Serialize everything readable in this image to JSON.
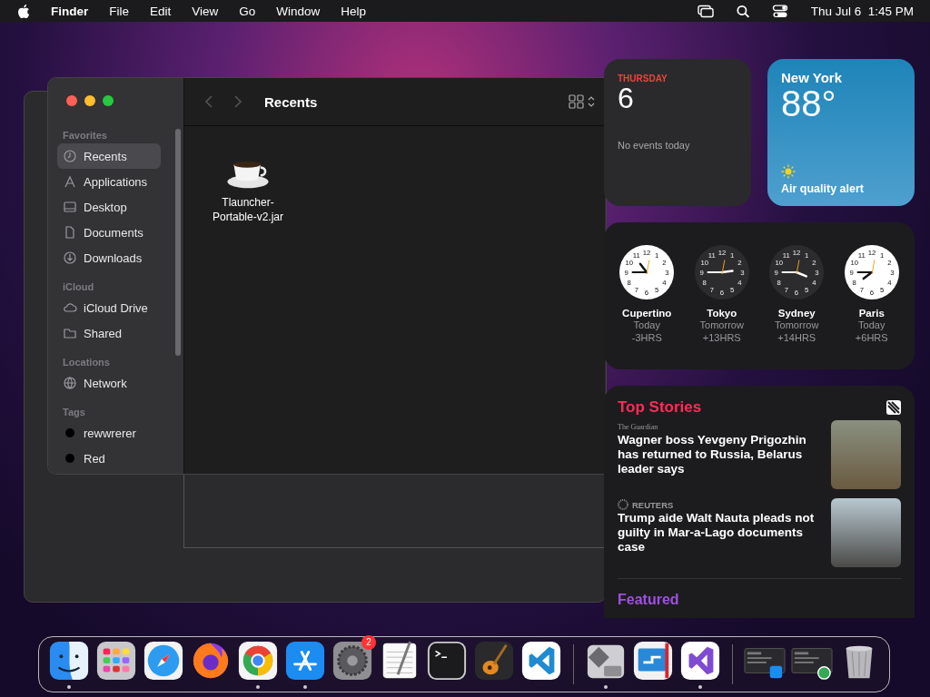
{
  "menu_bar": {
    "app": "Finder",
    "menus": [
      "File",
      "Edit",
      "View",
      "Go",
      "Window",
      "Help"
    ],
    "clock": "Thu Jul 6  1:45 PM"
  },
  "finder": {
    "title": "Recents",
    "sidebar": [
      {
        "heading": "Favorites",
        "items": [
          {
            "label": "Recents",
            "kind": "clock",
            "selected": true
          },
          {
            "label": "Applications",
            "kind": "apps",
            "selected": false
          },
          {
            "label": "Desktop",
            "kind": "desktop",
            "selected": false
          },
          {
            "label": "Documents",
            "kind": "doc",
            "selected": false
          },
          {
            "label": "Downloads",
            "kind": "download",
            "selected": false
          }
        ]
      },
      {
        "heading": "iCloud",
        "items": [
          {
            "label": "iCloud Drive",
            "kind": "cloud",
            "selected": false
          },
          {
            "label": "Shared",
            "kind": "folder",
            "selected": false
          }
        ]
      },
      {
        "heading": "Locations",
        "items": [
          {
            "label": "Network",
            "kind": "globe",
            "selected": false
          }
        ]
      },
      {
        "heading": "Tags",
        "items": [
          {
            "label": "rewwrerer",
            "kind": "tag",
            "color": "#000000",
            "selected": false
          },
          {
            "label": "Red",
            "kind": "tag",
            "color": "#000000",
            "selected": false
          }
        ]
      }
    ],
    "files": [
      {
        "name": "Tlauncher-\nPortable-v2.jar"
      }
    ]
  },
  "calendar_widget": {
    "weekday": "THURSDAY",
    "day": "6",
    "note": "No events today"
  },
  "weather_widget": {
    "city": "New York",
    "temperature": "88°",
    "alert": "Air quality alert"
  },
  "world_clock_widget": {
    "clocks": [
      {
        "city": "Cupertino",
        "day": "Today",
        "offset": "-3HRS",
        "kind": "light",
        "numerals": [
          "11",
          "12",
          "1",
          "10",
          "2",
          "9",
          "3",
          "8",
          "4",
          "7",
          "6",
          "5"
        ]
      },
      {
        "city": "Tokyo",
        "day": "Tomorrow",
        "offset": "+13HRS",
        "kind": "dark",
        "numerals": [
          "11",
          "12",
          "1",
          "10",
          "2",
          "9",
          "3",
          "8",
          "4",
          "7",
          "6",
          "5"
        ]
      },
      {
        "city": "Sydney",
        "day": "Tomorrow",
        "offset": "+14HRS",
        "kind": "dark",
        "numerals": [
          "11",
          "12",
          "1",
          "10",
          "2",
          "9",
          "3",
          "8",
          "4",
          "7",
          "6",
          "5"
        ]
      },
      {
        "city": "Paris",
        "day": "Today",
        "offset": "+6HRS",
        "kind": "light",
        "numerals": [
          "11",
          "12",
          "1",
          "10",
          "2",
          "9",
          "3",
          "8",
          "4",
          "7",
          "6",
          "5"
        ]
      }
    ]
  },
  "news_widget": {
    "heading": "Top Stories",
    "stories": [
      {
        "source": "The Guardian",
        "kind": "serif",
        "headline": "Wagner boss Yevgeny Prigozhin has returned to Russia, Belarus leader says"
      },
      {
        "source": "REUTERS",
        "kind": "logo",
        "headline": "Trump aide Walt Nauta pleads not guilty in Mar-a-Lago documents case"
      }
    ],
    "next_heading": "Featured"
  },
  "dock": {
    "items": [
      {
        "kind": "finder",
        "running": true
      },
      {
        "kind": "launchpad"
      },
      {
        "kind": "safari"
      },
      {
        "kind": "firefox"
      },
      {
        "kind": "chrome",
        "running": true
      },
      {
        "kind": "appstore",
        "running": true
      },
      {
        "kind": "settings",
        "badge": "2"
      },
      {
        "kind": "textedit"
      },
      {
        "kind": "terminal"
      },
      {
        "kind": "garageband"
      },
      {
        "kind": "vscode"
      },
      {
        "kind": "separator"
      },
      {
        "kind": "bootcamp",
        "running": true
      },
      {
        "kind": "remote"
      },
      {
        "kind": "visualstudio",
        "running": true
      },
      {
        "kind": "separator"
      },
      {
        "kind": "thumb_appstore"
      },
      {
        "kind": "thumb_chrome"
      },
      {
        "kind": "trash"
      }
    ]
  }
}
